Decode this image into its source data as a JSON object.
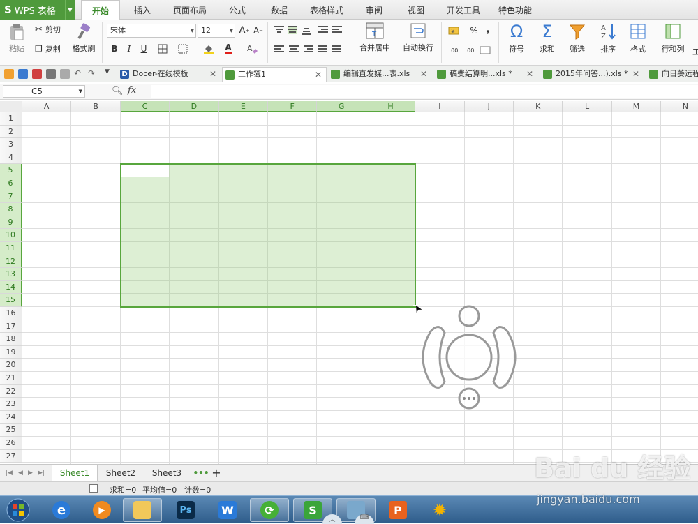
{
  "app": {
    "logo_letter": "S",
    "title": "WPS 表格"
  },
  "menu_tabs": [
    "开始",
    "插入",
    "页面布局",
    "公式",
    "数据",
    "表格样式",
    "审阅",
    "视图",
    "开发工具",
    "特色功能"
  ],
  "active_menu_tab": "开始",
  "ribbon": {
    "paste": "粘贴",
    "cut": "剪切",
    "copy": "复制",
    "format_painter": "格式刷",
    "font_name": "宋体",
    "font_size": "12",
    "bold": "B",
    "italic": "I",
    "underline": "U",
    "font_color_letter": "A",
    "grow_font": "A",
    "shrink_font": "A",
    "merge_center": "合并居中",
    "wrap_text": "自动换行",
    "percent": "%",
    "comma": "❟",
    "increase_decimal": ".00",
    "decrease_decimal": ".00",
    "symbol": "符号",
    "sum": "求和",
    "filter": "筛选",
    "sort": "排序",
    "format": "格式",
    "row_col": "行和列",
    "overflow_label": "工"
  },
  "doc_tabs": [
    {
      "label": "Docer-在线模板",
      "icon_color": "#2a5aa8",
      "active": false
    },
    {
      "label": "工作簿1",
      "icon_color": "#4f9a3c",
      "active": true
    },
    {
      "label": "编辑直发媒...表.xls",
      "icon_color": "#4f9a3c",
      "active": false
    },
    {
      "label": "稿费结算明...xls *",
      "icon_color": "#4f9a3c",
      "active": false
    },
    {
      "label": "2015年问答...).xls *",
      "icon_color": "#4f9a3c",
      "active": false
    },
    {
      "label": "向日葵远程",
      "icon_color": "#4f9a3c",
      "active": false
    }
  ],
  "formula_bar": {
    "cell_ref": "C5",
    "zoom_icon": "magnifier-icon",
    "fx": "fx",
    "content": ""
  },
  "grid": {
    "columns": [
      "A",
      "B",
      "C",
      "D",
      "E",
      "F",
      "G",
      "H",
      "I",
      "J",
      "K",
      "L",
      "M",
      "N"
    ],
    "rows": [
      "1",
      "2",
      "3",
      "4",
      "5",
      "6",
      "7",
      "8",
      "9",
      "10",
      "11",
      "12",
      "13",
      "14",
      "15",
      "16",
      "17",
      "18",
      "19",
      "20",
      "21",
      "22",
      "23",
      "24",
      "25",
      "26",
      "27"
    ],
    "selection": "C5:H15",
    "active_cell": "C5"
  },
  "sheets": [
    "Sheet1",
    "Sheet2",
    "Sheet3"
  ],
  "active_sheet": "Sheet1",
  "sheet_more": "•••",
  "sheet_add": "+",
  "status": {
    "sum": "求和=0",
    "average": "平均值=0",
    "count": "计数=0"
  },
  "taskbar_apps": [
    {
      "name": "start-orb",
      "running": false
    },
    {
      "name": "ie-icon",
      "running": false
    },
    {
      "name": "media-player-icon",
      "running": false
    },
    {
      "name": "explorer-icon",
      "running": true
    },
    {
      "name": "photoshop-icon",
      "label": "Ps",
      "running": false
    },
    {
      "name": "wps-writer-icon",
      "label": "W",
      "running": false
    },
    {
      "name": "refresh-app-icon",
      "running": true
    },
    {
      "name": "wps-spreadsheet-icon",
      "label": "S",
      "running": true
    },
    {
      "name": "network-app-icon",
      "running": true
    },
    {
      "name": "wps-presentation-icon",
      "label": "P",
      "running": false
    },
    {
      "name": "sun-app-icon",
      "running": false
    }
  ],
  "watermark": {
    "logo": "Bai du 经验",
    "url": "jingyan.baidu.com"
  },
  "colors": {
    "accent": "#4f9a3c",
    "selection_fill": "#d7ecc9",
    "selection_border": "#58a63d",
    "taskbar": "#2e5c8a"
  }
}
